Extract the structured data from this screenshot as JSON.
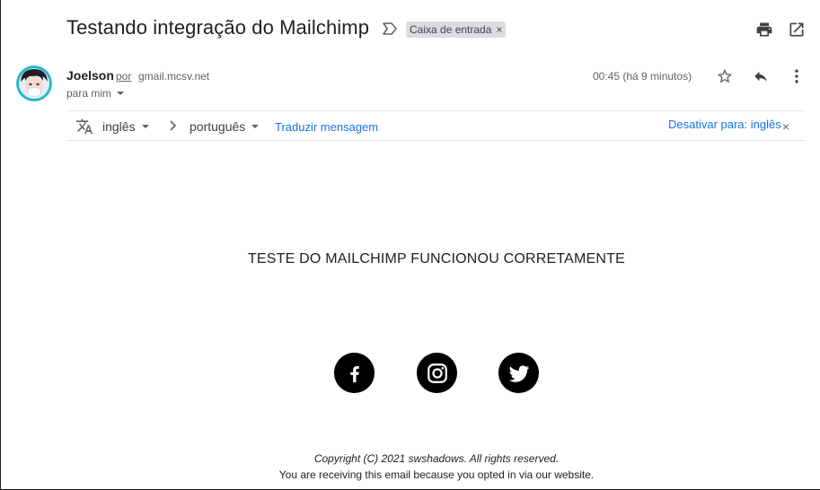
{
  "header": {
    "subject": "Testando integração do Mailchimp",
    "label": "Caixa de entrada",
    "label_remove": "×",
    "icons": [
      "importance-marker-icon",
      "print-icon",
      "open-in-new-window-icon"
    ]
  },
  "sender": {
    "name": "Joelson",
    "via_label": "por",
    "via_domain": "gmail.mcsv.net",
    "to": "para mim",
    "time": "00:45 (há 9 minutos)",
    "icons": [
      "star-icon",
      "reply-icon",
      "more-vertical-icon"
    ]
  },
  "translate": {
    "from_lang": "inglês",
    "to_lang": "português",
    "translate_link": "Traduzir mensagem",
    "disable_link": "Desativar para: inglês",
    "close": "×",
    "icons": [
      "translate-icon",
      "chevron-right-icon"
    ]
  },
  "message": {
    "body": "TESTE DO MAILCHIMP FUNCIONOU CORRETAMENTE",
    "social_icons": [
      "facebook-icon",
      "instagram-icon",
      "twitter-icon"
    ],
    "copyright": "Copyright (C) 2021 swshadows. All rights reserved.",
    "optin": "You are receiving this email because you opted in via our website."
  },
  "colors": {
    "link": "#1a73e8",
    "muted_text": "#5f6368",
    "label_chip_bg": "#dadce0",
    "social_bg": "#000000"
  }
}
